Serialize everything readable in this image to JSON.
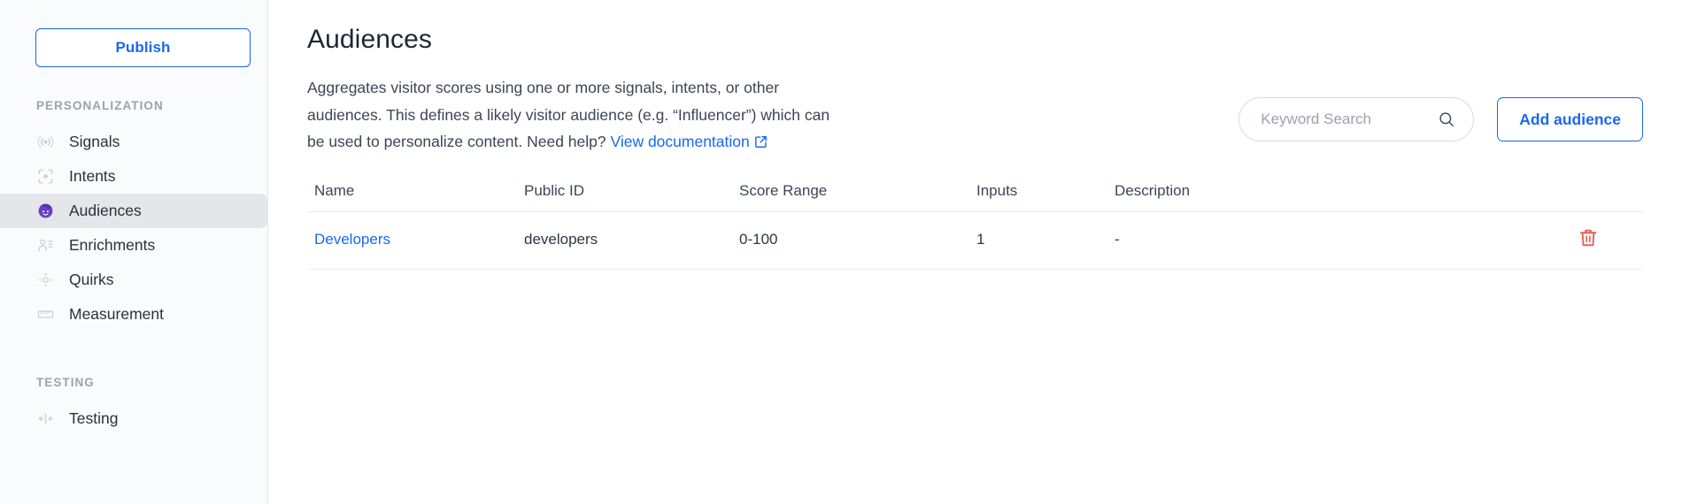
{
  "sidebar": {
    "publish_label": "Publish",
    "sections": [
      {
        "label": "PERSONALIZATION",
        "items": [
          {
            "label": "Signals",
            "icon": "signal-icon",
            "active": false
          },
          {
            "label": "Intents",
            "icon": "target-icon",
            "active": false
          },
          {
            "label": "Audiences",
            "icon": "audience-face-icon",
            "active": true
          },
          {
            "label": "Enrichments",
            "icon": "person-list-icon",
            "active": false
          },
          {
            "label": "Quirks",
            "icon": "move-arrows-icon",
            "active": false
          },
          {
            "label": "Measurement",
            "icon": "ruler-icon",
            "active": false
          }
        ]
      },
      {
        "label": "TESTING",
        "items": [
          {
            "label": "Testing",
            "icon": "arrows-horizontal-icon",
            "active": false
          }
        ]
      }
    ]
  },
  "main": {
    "title": "Audiences",
    "description_part1": "Aggregates visitor scores using one or more signals, intents, or other audiences. This defines a likely visitor audience (e.g. “Influencer”) which can be used to personalize content. Need help? ",
    "doc_link_label": "View documentation",
    "search": {
      "placeholder": "Keyword Search",
      "value": ""
    },
    "add_button_label": "Add audience",
    "table": {
      "columns": [
        "Name",
        "Public ID",
        "Score Range",
        "Inputs",
        "Description"
      ],
      "rows": [
        {
          "name": "Developers",
          "public_id": "developers",
          "score_range": "0-100",
          "inputs": "1",
          "description": "-"
        }
      ]
    }
  },
  "colors": {
    "accent_blue": "#1868f5",
    "delete_red": "#e2685c",
    "audience_purple": "#6b3fc4",
    "sidebar_bg": "#fafbfc",
    "active_item_bg": "#e4e6e9"
  }
}
